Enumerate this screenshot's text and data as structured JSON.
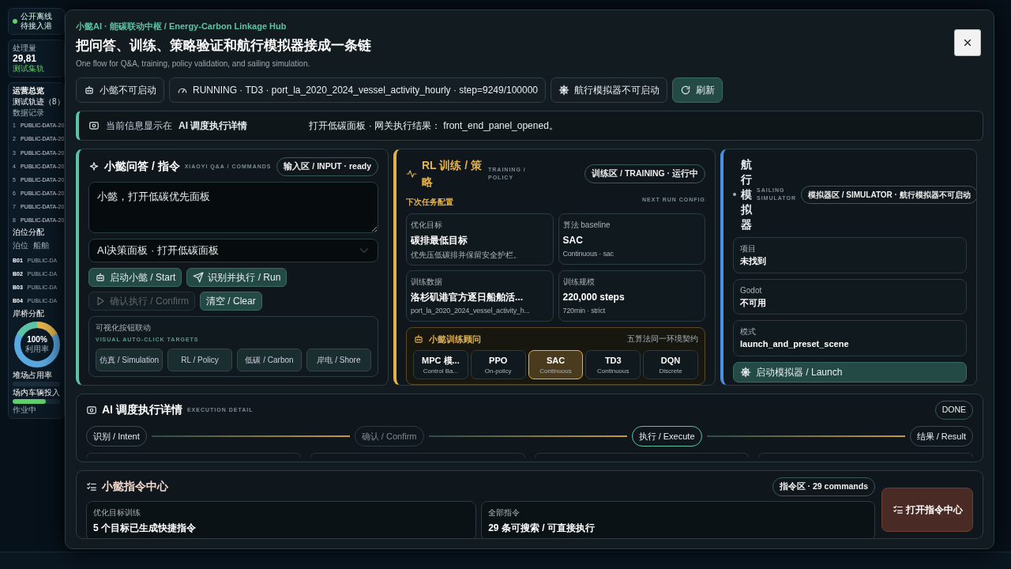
{
  "background": {
    "banner": [
      "公开离线",
      "待接入港"
    ],
    "kpi": {
      "label": "处理量",
      "value": "29,81",
      "note": "测试集轨"
    },
    "overview": {
      "title": "运营总览",
      "tracks_title": "测试轨迹（8）",
      "tracks_sub": "数据记录",
      "tracks": [
        {
          "index": "1",
          "name": "PUBLIC-DATA-20"
        },
        {
          "index": "2",
          "name": "PUBLIC-DATA-20"
        },
        {
          "index": "3",
          "name": "PUBLIC-DATA-20"
        },
        {
          "index": "4",
          "name": "PUBLIC-DATA-20"
        },
        {
          "index": "5",
          "name": "PUBLIC-DATA-20"
        },
        {
          "index": "6",
          "name": "PUBLIC-DATA-20"
        },
        {
          "index": "7",
          "name": "PUBLIC-DATA-20"
        },
        {
          "index": "8",
          "name": "PUBLIC-DATA-20"
        }
      ]
    },
    "berth": {
      "title": "泊位分配",
      "columns": [
        "泊位",
        "船舶"
      ],
      "rows": [
        [
          "B01",
          "PUBLIC-DA"
        ],
        [
          "B02",
          "PUBLIC-DA"
        ],
        [
          "B03",
          "PUBLIC-DA"
        ],
        [
          "B04",
          "PUBLIC-DA"
        ]
      ]
    },
    "crane": {
      "title": "岸桥分配",
      "value": "100%",
      "label": "利用率"
    },
    "yard": {
      "title": "堆场占用率"
    },
    "vehicles": {
      "title": "场内车辆投入",
      "status": "作业中",
      "level": 0.7
    }
  },
  "modal": {
    "kicker": "小懿AI · 能碳联动中枢 / Energy-Carbon Linkage Hub",
    "title": "把问答、训练、策略验证和航行模拟器接成一条链",
    "description": "One flow for Q&A, training, policy validation, and sailing simulation.",
    "status_chips": [
      {
        "kind": "robot",
        "label": "小懿不可启动"
      },
      {
        "kind": "gauge",
        "label": "RUNNING · TD3 · port_la_2020_2024_vessel_activity_hourly · step=9249/100000"
      },
      {
        "kind": "helm",
        "label": "航行模拟器不可启动"
      },
      {
        "kind": "refresh",
        "label": "刷新"
      }
    ],
    "info": {
      "prefix": "当前信息显示在",
      "target": "AI 调度执行详情",
      "message": "打开低碳面板 · 网关执行结果： front_end_panel_opened。"
    }
  },
  "qa": {
    "title": "小懿问答 / 指令",
    "subtitle": "XIAOYI Q&A / COMMANDS",
    "badge": "输入区 / INPUT · ready",
    "input": "小懿，打开低碳优先面板",
    "select": "AI决策面板 · 打开低碳面板",
    "buttons": [
      {
        "kind": "robot",
        "label": "启动小懿 / Start",
        "disabled": false
      },
      {
        "kind": "send",
        "label": "识别并执行 / Run",
        "disabled": false
      },
      {
        "kind": "play",
        "label": "确认执行 / Confirm",
        "disabled": true
      },
      {
        "kind": "none",
        "label": "清空 / Clear",
        "disabled": false
      }
    ],
    "targets": {
      "title": "可视化按钮联动",
      "subtitle": "VISUAL AUTO-CLICK TARGETS",
      "items": [
        "仿真 / Simulation",
        "RL / Policy",
        "低碳 / Carbon",
        "岸电 / Shore"
      ]
    }
  },
  "training": {
    "title": "RL 训练 / 策略",
    "subtitle": "TRAINING / POLICY",
    "badge": "训练区 / TRAINING · 运行中",
    "section": "下次任务配置",
    "section_en": "NEXT RUN CONFIG",
    "config": [
      {
        "label": "优化目标",
        "value": "碳排最低目标",
        "note": "优先压低碳排并保留安全护栏。"
      },
      {
        "label": "算法 baseline",
        "value": "SAC",
        "note": "Continuous · sac"
      },
      {
        "label": "训练数据",
        "value": "洛杉矶港官方逐日船舶活...",
        "note": "port_la_2020_2024_vessel_activity_h..."
      },
      {
        "label": "训练规模",
        "value": "220,000 steps",
        "note": "720min · strict"
      }
    ],
    "advisor": {
      "title": "小懿训练顾问",
      "note": "五算法同一环境契约",
      "algorithms": [
        {
          "name": "MPC 模...",
          "sub": "Control Ba...",
          "selected": false
        },
        {
          "name": "PPO",
          "sub": "On-policy",
          "selected": false
        },
        {
          "name": "SAC",
          "sub": "Continuous",
          "selected": true
        },
        {
          "name": "TD3",
          "sub": "Continuous",
          "selected": false
        },
        {
          "name": "DQN",
          "sub": "Discrete",
          "selected": false
        }
      ]
    }
  },
  "simulator": {
    "title": "航行模拟器",
    "subtitle": "SAILING SIMULATOR",
    "badge": "模拟器区 / SIMULATOR · 航行模拟器不可启动",
    "fields": [
      {
        "label": "项目",
        "value": "未找到"
      },
      {
        "label": "Godot",
        "value": "不可用"
      },
      {
        "label": "模式",
        "value": "launch_and_preset_scene"
      }
    ],
    "launch": "启动模拟器 / Launch"
  },
  "execution": {
    "title": "AI 调度执行详情",
    "subtitle": "EXECUTION DETAIL",
    "badge": "DONE",
    "steps": [
      {
        "label": "识别 / Intent",
        "current": false,
        "disabled": false
      },
      {
        "label": "确认 / Confirm",
        "current": false,
        "disabled": true
      },
      {
        "label": "执行 / Execute",
        "current": true,
        "disabled": false
      },
      {
        "label": "结果 / Result",
        "current": false,
        "disabled": false
      }
    ]
  },
  "commands": {
    "title": "小懿指令中心",
    "badge": "指令区 · 29 commands",
    "cards": [
      {
        "label": "优化目标训练",
        "value": "5 个目标已生成快捷指令"
      },
      {
        "label": "全部指令",
        "value": "29 条可搜索 / 可直接执行"
      }
    ],
    "open": "打开指令中心"
  }
}
